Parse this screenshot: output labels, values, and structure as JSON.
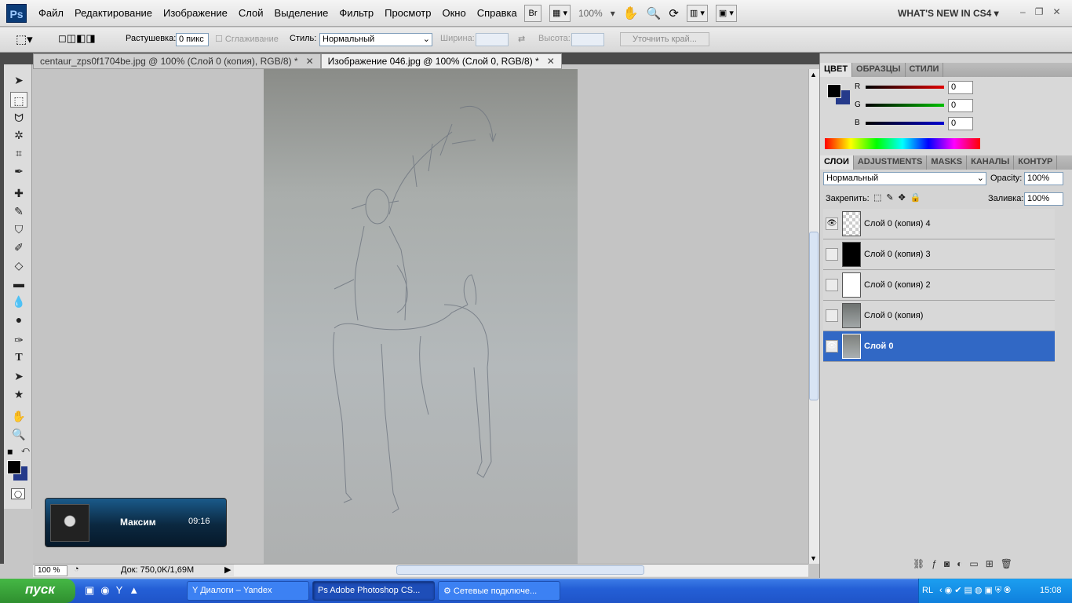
{
  "app": {
    "logo": "Ps"
  },
  "menu": [
    "Файл",
    "Редактирование",
    "Изображение",
    "Слой",
    "Выделение",
    "Фильтр",
    "Просмотр",
    "Окно",
    "Справка"
  ],
  "toolbar": {
    "bridge": "Br",
    "zoom": "100%",
    "workspace": "WHAT'S NEW IN CS4"
  },
  "options": {
    "feather_label": "Растушевка:",
    "feather_value": "0 пикс",
    "antialias_label": "Сглаживание",
    "style_label": "Стиль:",
    "style_value": "Нормальный",
    "width_label": "Ширина:",
    "height_label": "Высота:",
    "refine_label": "Уточнить край..."
  },
  "tabs": [
    {
      "label": "centaur_zps0f1704be.jpg @ 100% (Слой 0 (копия), RGB/8) *"
    },
    {
      "label": "Изображение 046.jpg @ 100% (Слой 0, RGB/8) *"
    }
  ],
  "status": {
    "zoom": "100 %",
    "doc": "Док: 750,0K/1,69M"
  },
  "notification": {
    "name": "Максим",
    "time": "09:16"
  },
  "color_panel": {
    "tabs": [
      "ЦВЕТ",
      "ОБРАЗЦЫ",
      "СТИЛИ"
    ],
    "channels": [
      {
        "label": "R",
        "value": "0",
        "color": "#e00000"
      },
      {
        "label": "G",
        "value": "0",
        "color": "#00c000"
      },
      {
        "label": "B",
        "value": "0",
        "color": "#0000d0"
      }
    ]
  },
  "layers_panel": {
    "tabs": [
      "СЛОИ",
      "ADJUSTMENTS",
      "MASKS",
      "КАНАЛЫ",
      "КОНТУР"
    ],
    "blend": "Нормальный",
    "opacity_label": "Opacity:",
    "opacity": "100%",
    "lock_label": "Закрепить:",
    "fill_label": "Заливка:",
    "fill": "100%",
    "layers": [
      {
        "name": "Слой 0 (копия) 4",
        "visible": "👁",
        "selected": false
      },
      {
        "name": "Слой 0 (копия) 3",
        "visible": "",
        "selected": false
      },
      {
        "name": "Слой 0 (копия) 2",
        "visible": "",
        "selected": false
      },
      {
        "name": "Слой 0 (копия)",
        "visible": "",
        "selected": false
      },
      {
        "name": "Слой 0",
        "visible": "👁",
        "selected": true
      }
    ]
  },
  "taskbar": {
    "start": "пуск",
    "tasks": [
      "Диалоги – Yandex",
      "Adobe Photoshop CS...",
      "Сетевые подключе..."
    ],
    "lang": "RL",
    "clock": "15:08"
  }
}
